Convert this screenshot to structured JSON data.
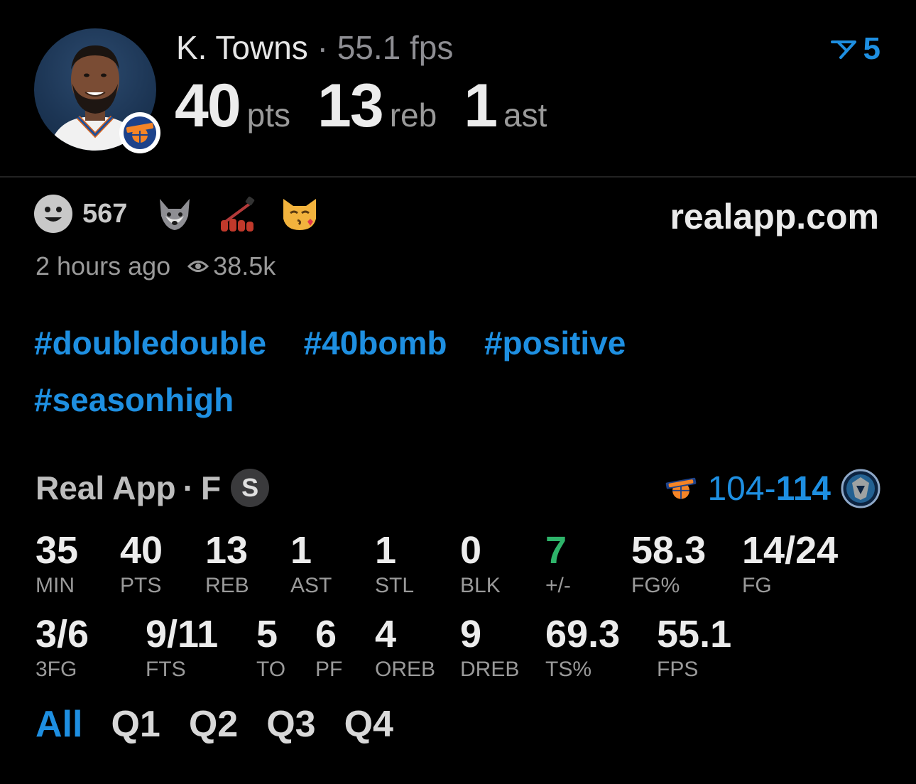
{
  "header": {
    "player_name": "K. Towns",
    "separator": "·",
    "fps_text": "55.1 fps",
    "pts_value": "40",
    "pts_unit": "pts",
    "reb_value": "13",
    "reb_unit": "reb",
    "ast_value": "1",
    "ast_unit": "ast",
    "votes": "5"
  },
  "reactions": {
    "count": "567",
    "emoji_icons": [
      "wolf-icon",
      "nail-polish-icon",
      "kissing-cat-icon"
    ]
  },
  "site": "realapp.com",
  "meta": {
    "time_ago": "2 hours ago",
    "views": "38.5k"
  },
  "hashtags": [
    "#doubledouble",
    "#40bomb",
    "#positive",
    "#seasonhigh"
  ],
  "game": {
    "source": "Real App",
    "dot": "·",
    "status": "F",
    "badge": "S",
    "score_away": "104",
    "score_dash": "-",
    "score_home": "114"
  },
  "stats_row1": [
    {
      "value": "35",
      "label": "MIN"
    },
    {
      "value": "40",
      "label": "PTS"
    },
    {
      "value": "13",
      "label": "REB"
    },
    {
      "value": "1",
      "label": "AST"
    },
    {
      "value": "1",
      "label": "STL"
    },
    {
      "value": "0",
      "label": "BLK"
    },
    {
      "value": "7",
      "label": "+/-"
    },
    {
      "value": "58.3",
      "label": "FG%"
    },
    {
      "value": "14/24",
      "label": "FG"
    }
  ],
  "stats_row2": [
    {
      "value": "3/6",
      "label": "3FG"
    },
    {
      "value": "9/11",
      "label": "FTS"
    },
    {
      "value": "5",
      "label": "TO"
    },
    {
      "value": "6",
      "label": "PF"
    },
    {
      "value": "4",
      "label": "OREB"
    },
    {
      "value": "9",
      "label": "DREB"
    },
    {
      "value": "69.3",
      "label": "TS%"
    },
    {
      "value": "55.1",
      "label": "FPS"
    }
  ],
  "tabs": [
    "All",
    "Q1",
    "Q2",
    "Q3",
    "Q4"
  ],
  "colors": {
    "accent": "#1e8fe1",
    "positive": "#2eb46a",
    "background": "#000000"
  }
}
